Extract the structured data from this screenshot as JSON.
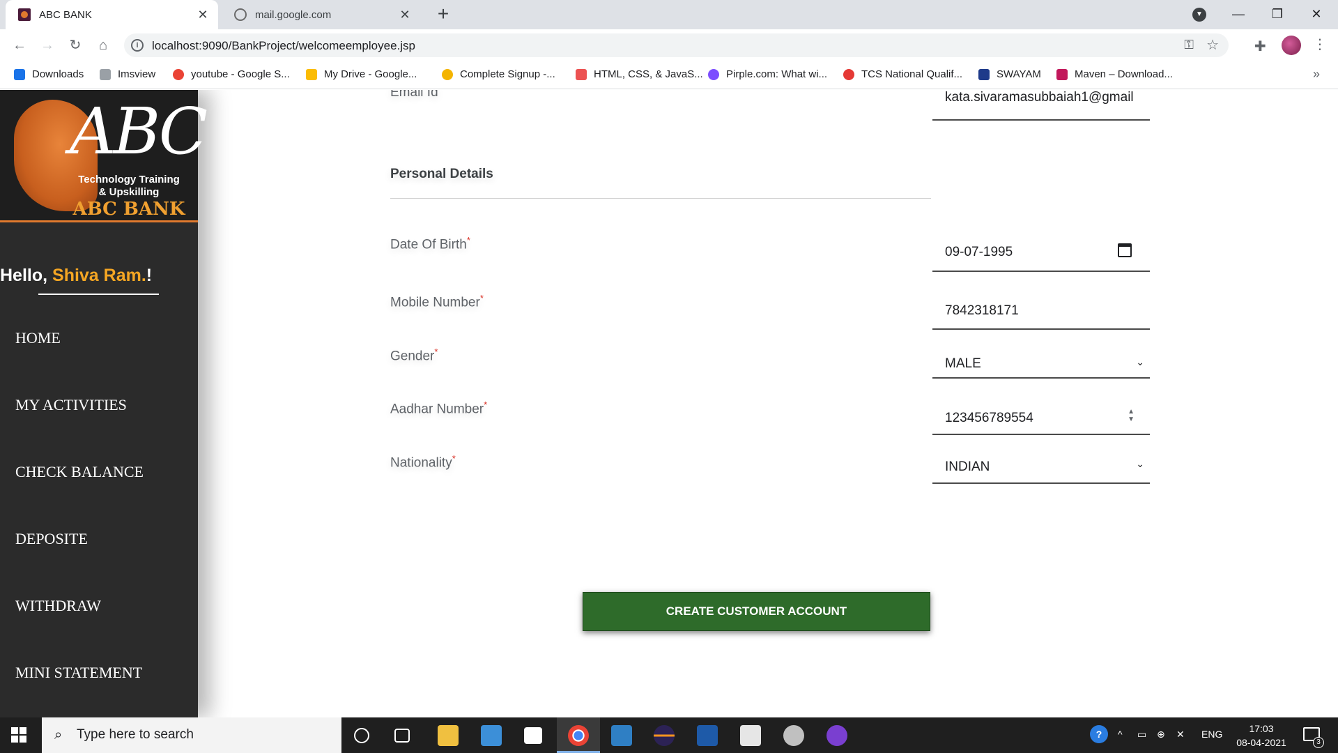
{
  "browser": {
    "tabs": [
      {
        "title": "ABC BANK",
        "active": true
      },
      {
        "title": "mail.google.com",
        "active": false
      }
    ],
    "url": "localhost:9090/BankProject/welcomeemployee.jsp",
    "bookmarks": [
      {
        "label": "Downloads",
        "icon": "download-icon"
      },
      {
        "label": "Imsview",
        "icon": "grid-icon"
      },
      {
        "label": "youtube - Google S...",
        "icon": "google-icon"
      },
      {
        "label": "My Drive - Google...",
        "icon": "drive-icon"
      },
      {
        "label": "Complete Signup -...",
        "icon": "gear-icon"
      },
      {
        "label": "HTML, CSS, & JavaS...",
        "icon": "udemy-icon"
      },
      {
        "label": "Pirple.com: What wi...",
        "icon": "pirple-icon"
      },
      {
        "label": "TCS National Qualif...",
        "icon": "tcs-icon"
      },
      {
        "label": "SWAYAM",
        "icon": "swayam-icon"
      },
      {
        "label": "Maven – Download...",
        "icon": "maven-icon"
      }
    ]
  },
  "sidebar": {
    "logo": {
      "abc": "ABC",
      "tagline_1": "Technology Training",
      "tagline_2": "& Upskilling",
      "bank_name": "ABC BANK"
    },
    "greeting_prefix": "Hello, ",
    "user_name": "Shiva Ram.",
    "greeting_suffix": "!",
    "nav": [
      "HOME",
      "MY ACTIVITIES",
      "CHECK BALANCE",
      "DEPOSITE",
      "WITHDRAW",
      "MINI STATEMENT"
    ]
  },
  "form": {
    "email": {
      "label": "Email Id",
      "value": "kata.sivaramasubbaiah1@gmail"
    },
    "section_title": "Personal Details",
    "dob": {
      "label": "Date Of Birth",
      "value": "09-07-1995"
    },
    "mobile": {
      "label": "Mobile Number",
      "value": "7842318171"
    },
    "gender": {
      "label": "Gender",
      "value": "MALE"
    },
    "aadhar": {
      "label": "Aadhar Number",
      "value": "123456789554"
    },
    "nationality": {
      "label": "Nationality",
      "value": "INDIAN"
    },
    "required_marker": "*",
    "submit_label": "CREATE CUSTOMER ACCOUNT"
  },
  "taskbar": {
    "search_placeholder": "Type here to search",
    "language": "ENG",
    "time": "17:03",
    "date": "08-04-2021",
    "notification_count": "3"
  },
  "colors": {
    "sidebar_bg": "#2b2b2b",
    "accent_orange": "#f5a623",
    "button_green": "#2e6b2a",
    "required_red": "#d93025"
  }
}
